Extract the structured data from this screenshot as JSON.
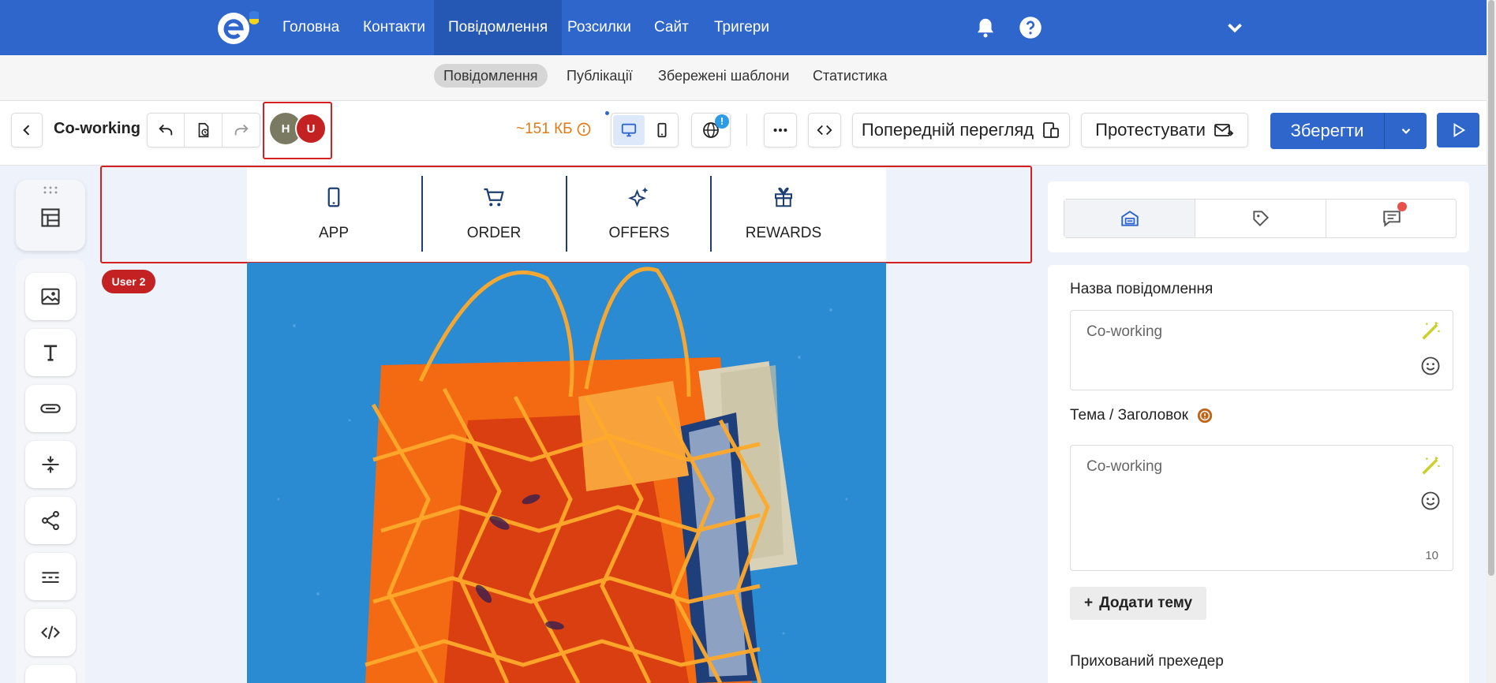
{
  "topnav": {
    "items": [
      {
        "label": "Головна"
      },
      {
        "label": "Контакти"
      },
      {
        "label": "Повідомлення"
      },
      {
        "label": "Розсилки"
      },
      {
        "label": "Сайт"
      },
      {
        "label": "Тригери"
      }
    ],
    "active": "Повідомлення",
    "icons": [
      "bell-icon",
      "help-icon",
      "chevron-down-icon"
    ],
    "colors": {
      "bar": "#2e66cc",
      "active": "#2557b5"
    }
  },
  "subnav": {
    "items": [
      {
        "label": "Повідомлення"
      },
      {
        "label": "Публікації"
      },
      {
        "label": "Збережені шаблони"
      },
      {
        "label": "Статистика"
      }
    ],
    "active": "Повідомлення"
  },
  "toolbar": {
    "title": "Co-working",
    "avatars": [
      {
        "initial": "H",
        "color": "#7a7a62"
      },
      {
        "initial": "U",
        "color": "#c42222"
      }
    ],
    "size": "~151 КБ",
    "preview_label": "Попередній перегляд",
    "test_label": "Протестувати",
    "save_label": "Зберегти",
    "accent": "#2e66cc"
  },
  "tools": [
    "grid-icon",
    "image-icon",
    "text-icon",
    "button-icon",
    "spacer-icon",
    "share-icon",
    "divider-icon",
    "code-icon"
  ],
  "email": {
    "nav": [
      {
        "label": "APP",
        "icon": "phone-icon"
      },
      {
        "label": "ORDER",
        "icon": "cart-icon"
      },
      {
        "label": "OFFERS",
        "icon": "sparkle-icon"
      },
      {
        "label": "REWARDS",
        "icon": "gift-icon"
      }
    ],
    "user_tag": "User 2"
  },
  "right_panel": {
    "tabs": [
      "settings-icon",
      "tag-icon",
      "chat-icon"
    ],
    "name_label": "Назва повідомлення",
    "name_value": "Co-working",
    "subject_label": "Тема / Заголовок",
    "subject_value": "Co-working",
    "subject_count": "10",
    "add_subject": "Додати тему",
    "preheader_label": "Прихований прехедер"
  }
}
